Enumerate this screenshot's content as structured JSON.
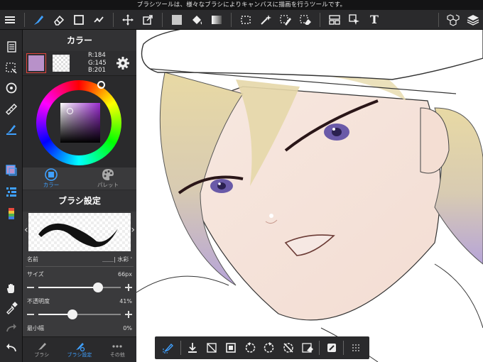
{
  "hint": "ブラシツールは、様々なブラシによりキャンバスに描画を行うツールです。",
  "color_panel": {
    "title": "カラー",
    "rgb": {
      "r": "R:184",
      "g": "G:145",
      "b": "B:201"
    },
    "main_color": "#b891c9",
    "tabs": [
      {
        "label": "カラー",
        "active": true
      },
      {
        "label": "パレット",
        "active": false
      }
    ]
  },
  "brush_panel": {
    "title": "ブラシ設定",
    "name_label": "名前",
    "name_value": "＿＿| 水彩 '",
    "size_label": "サイズ",
    "size_value": "66px",
    "size_level": 0.72,
    "opacity_label": "不透明度",
    "opacity_value": "41%",
    "opacity_level": 0.41,
    "min_width_label": "最小幅",
    "min_width_value": "0%"
  },
  "bottom_tabs": [
    {
      "label": "ブラシ",
      "active": false
    },
    {
      "label": "ブラシ設定",
      "active": true
    },
    {
      "label": "その他",
      "active": false
    }
  ],
  "accent_color": "#3fa0ff"
}
